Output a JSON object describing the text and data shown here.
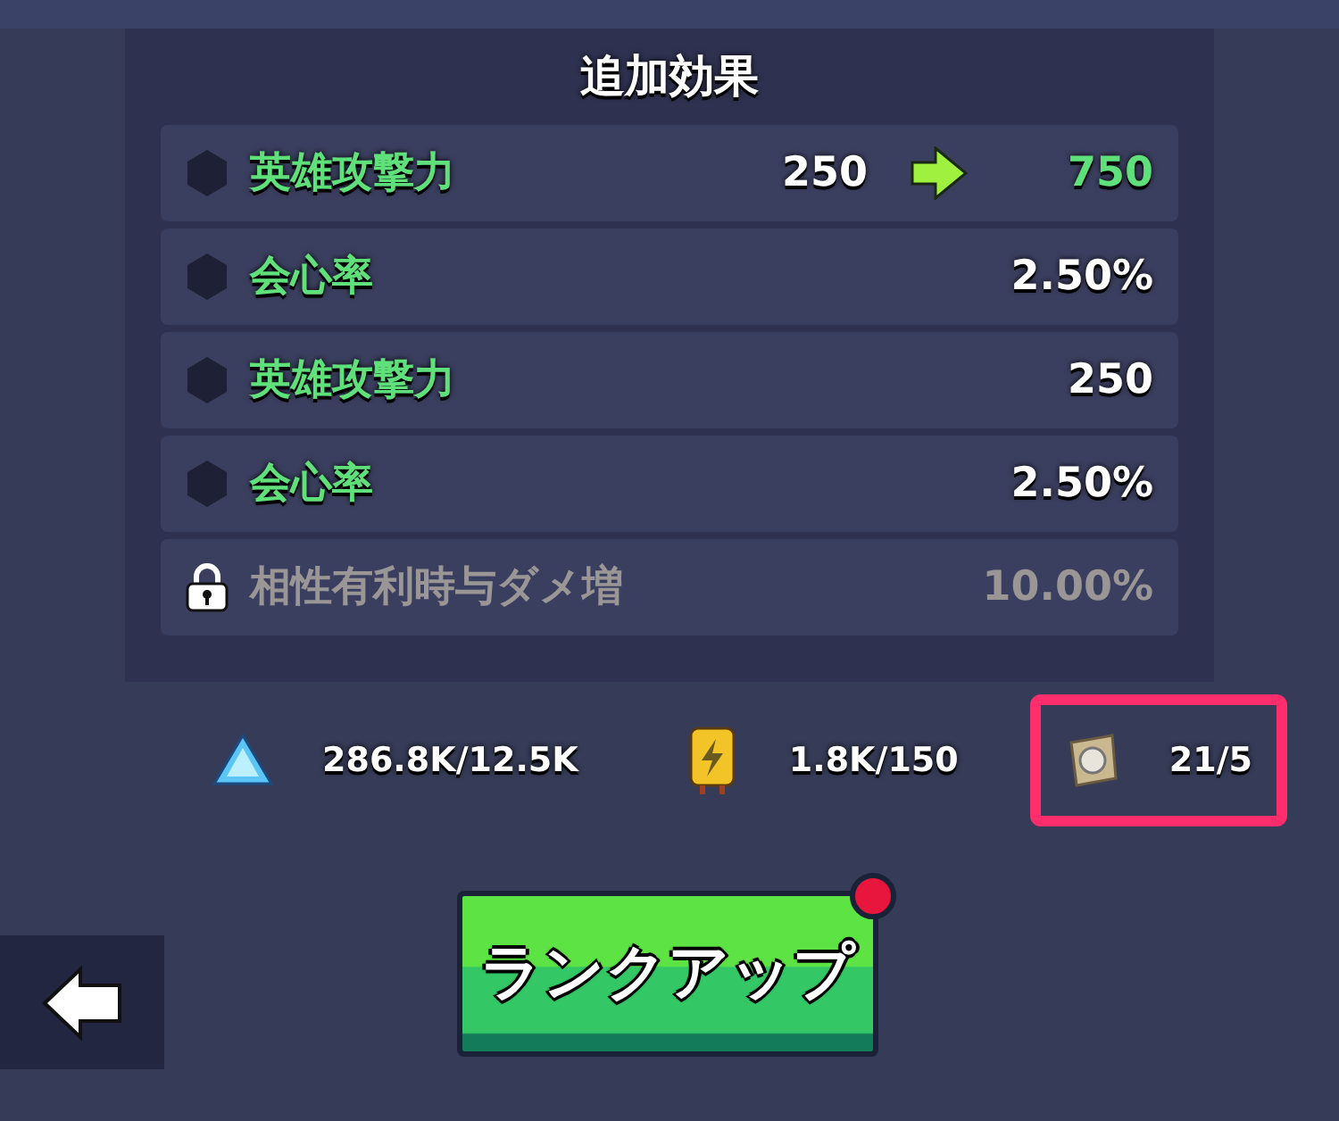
{
  "panel": {
    "title": "追加効果",
    "effects": [
      {
        "kind": "upgrade",
        "label": "英雄攻撃力",
        "value": "250",
        "new_value": "750",
        "locked": false
      },
      {
        "kind": "stat",
        "label": "会心率",
        "value": "2.50%",
        "locked": false
      },
      {
        "kind": "stat",
        "label": "英雄攻撃力",
        "value": "250",
        "locked": false
      },
      {
        "kind": "stat",
        "label": "会心率",
        "value": "2.50%",
        "locked": false
      },
      {
        "kind": "stat",
        "label": "相性有利時与ダメ増",
        "value": "10.00%",
        "locked": true
      }
    ]
  },
  "resources": [
    {
      "kind": "crystal",
      "amount": "286.8K/12.5K",
      "highlighted": false
    },
    {
      "kind": "battery",
      "amount": "1.8K/150",
      "highlighted": false
    },
    {
      "kind": "scroll",
      "amount": "21/5",
      "highlighted": true
    }
  ],
  "rank_up_button": {
    "label": "ランクアップ",
    "notification": true
  }
}
